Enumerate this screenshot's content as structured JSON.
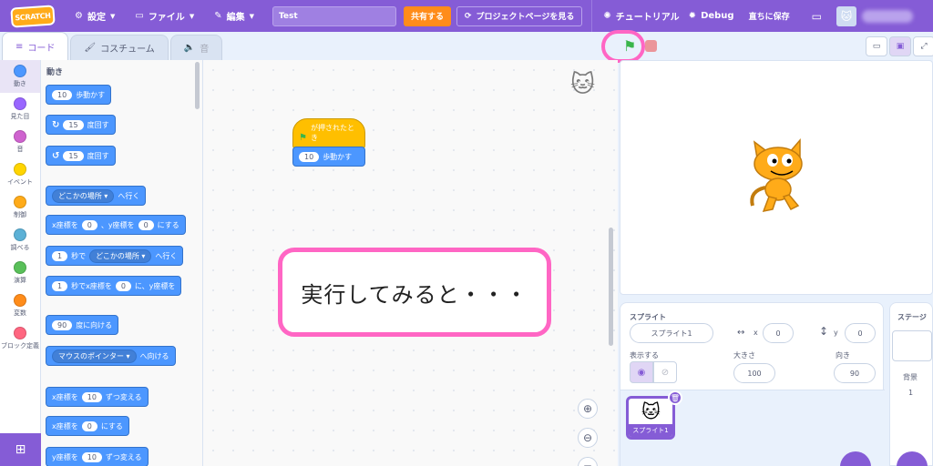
{
  "menubar": {
    "logo": "SCRATCH",
    "settings": "設定",
    "file": "ファイル",
    "edit": "編集",
    "project_title": "Test",
    "share": "共有する",
    "project_page": "プロジェクトページを見る",
    "tutorials": "チュートリアル",
    "debug": "Debug",
    "save_now": "直ちに保存"
  },
  "tabs": {
    "code": "コード",
    "costumes": "コスチューム",
    "sounds": "音"
  },
  "categories": [
    {
      "label": "動き",
      "color": "#4c97ff"
    },
    {
      "label": "見た目",
      "color": "#9966ff"
    },
    {
      "label": "音",
      "color": "#cf63cf"
    },
    {
      "label": "イベント",
      "color": "#ffd500"
    },
    {
      "label": "制御",
      "color": "#ffab19"
    },
    {
      "label": "調べる",
      "color": "#5cb1d6"
    },
    {
      "label": "演算",
      "color": "#59c059"
    },
    {
      "label": "変数",
      "color": "#ff8c1a"
    },
    {
      "label": "ブロック定義",
      "color": "#ff6680"
    }
  ],
  "palette": {
    "title": "動き",
    "move_steps": "10",
    "move_label": "歩動かす",
    "turn_right_deg": "15",
    "turn_label": "度回す",
    "turn_left_deg": "15",
    "goto_menu": "どこかの場所",
    "goto_label": "へ行く",
    "x_label": "x座標を",
    "x_val": "0",
    "y_label": "、y座標を",
    "y_val": "0",
    "goto_xy_label": "にする",
    "glide_secs": "1",
    "glide_label": "秒で",
    "glide_menu": "どこかの場所",
    "glide_to": "へ行く",
    "glide2_secs": "1",
    "glide2_label": "秒でx座標を",
    "glide2_x": "0",
    "glide2_mid": "に、y座標を",
    "point_dir": "90",
    "point_label": "度に向ける",
    "point_menu": "マウスのポインター",
    "point_to": "へ向ける",
    "change_x_label": "x座標を",
    "change_x_val": "10",
    "change_by": "ずつ変える",
    "set_x_label": "x座標を",
    "set_x_val": "0",
    "set_to": "にする",
    "change_y_label": "y座標を",
    "change_y_val": "10",
    "change_y_by": "ずつ変える"
  },
  "script": {
    "hat_label": "が押されたとき",
    "steps": "10",
    "move_label": "歩動かす"
  },
  "callout": "実行してみると・・・",
  "sprite_info": {
    "section": "スプライト",
    "name": "スプライト1",
    "x_label": "x",
    "x": "0",
    "y_label": "y",
    "y": "0",
    "show_label": "表示する",
    "size_label": "大きさ",
    "size": "100",
    "direction_label": "向き",
    "direction": "90",
    "thumb_name": "スプライト1"
  },
  "stage_panel": {
    "title": "ステージ",
    "backdrop_label": "背景",
    "backdrop_count": "1"
  }
}
